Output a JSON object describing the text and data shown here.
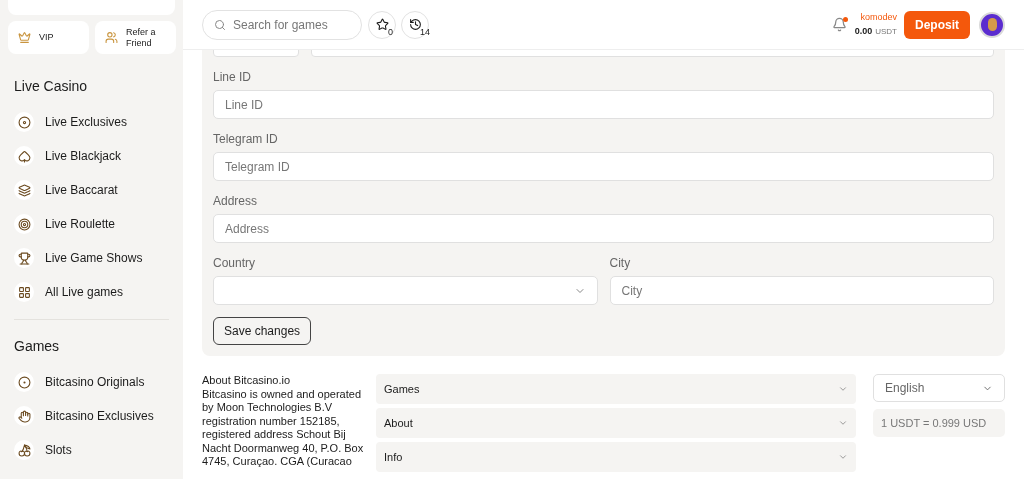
{
  "sidebar": {
    "promo_buttons": [
      {
        "kind": "crown",
        "label": "VIP"
      },
      {
        "kind": "people",
        "label": "Refer a Friend"
      }
    ],
    "sections": [
      {
        "title": "Live Casino",
        "items": [
          {
            "kind": "chip",
            "label": "Live Exclusives"
          },
          {
            "kind": "spade",
            "label": "Live Blackjack"
          },
          {
            "kind": "cards",
            "label": "Live Baccarat"
          },
          {
            "kind": "wheel",
            "label": "Live Roulette"
          },
          {
            "kind": "cup",
            "label": "Live Game Shows"
          },
          {
            "kind": "grid",
            "label": "All Live games"
          }
        ]
      },
      {
        "title": "Games",
        "items": [
          {
            "kind": "swirl",
            "label": "Bitcasino Originals"
          },
          {
            "kind": "hand",
            "label": "Bitcasino Exclusives"
          },
          {
            "kind": "cherry",
            "label": "Slots"
          }
        ]
      }
    ]
  },
  "header": {
    "search": {
      "placeholder": "Search for games"
    },
    "favorites_count": "0",
    "recent_count": "14",
    "notification_unread": true,
    "username": "komodev",
    "balance": "0.00",
    "currency": "USDT",
    "deposit_button": "Deposit"
  },
  "form": {
    "fields": [
      {
        "label": "Line ID",
        "placeholder": "Line ID"
      },
      {
        "label": "Telegram ID",
        "placeholder": "Telegram ID"
      },
      {
        "label": "Address",
        "placeholder": "Address"
      }
    ],
    "pair": [
      {
        "kind": "select",
        "label": "Country"
      },
      {
        "kind": "text",
        "label": "City",
        "placeholder": "City"
      }
    ],
    "save_button": "Save changes"
  },
  "footer": {
    "about_title": "About Bitcasino.io",
    "about_text": "Bitcasino is owned and operated by Moon Technologies B.V registration number 152185, registered address Schout Bij Nacht Doormanweg 40, P.O. Box 4745, Curaçao. CGA (Curacao",
    "accordions": [
      {
        "label": "Games",
        "expanded": false
      },
      {
        "label": "About",
        "expanded": false
      },
      {
        "label": "Info",
        "expanded": false
      }
    ],
    "language": "English",
    "rate": "1 USDT = 0.999 USD"
  }
}
